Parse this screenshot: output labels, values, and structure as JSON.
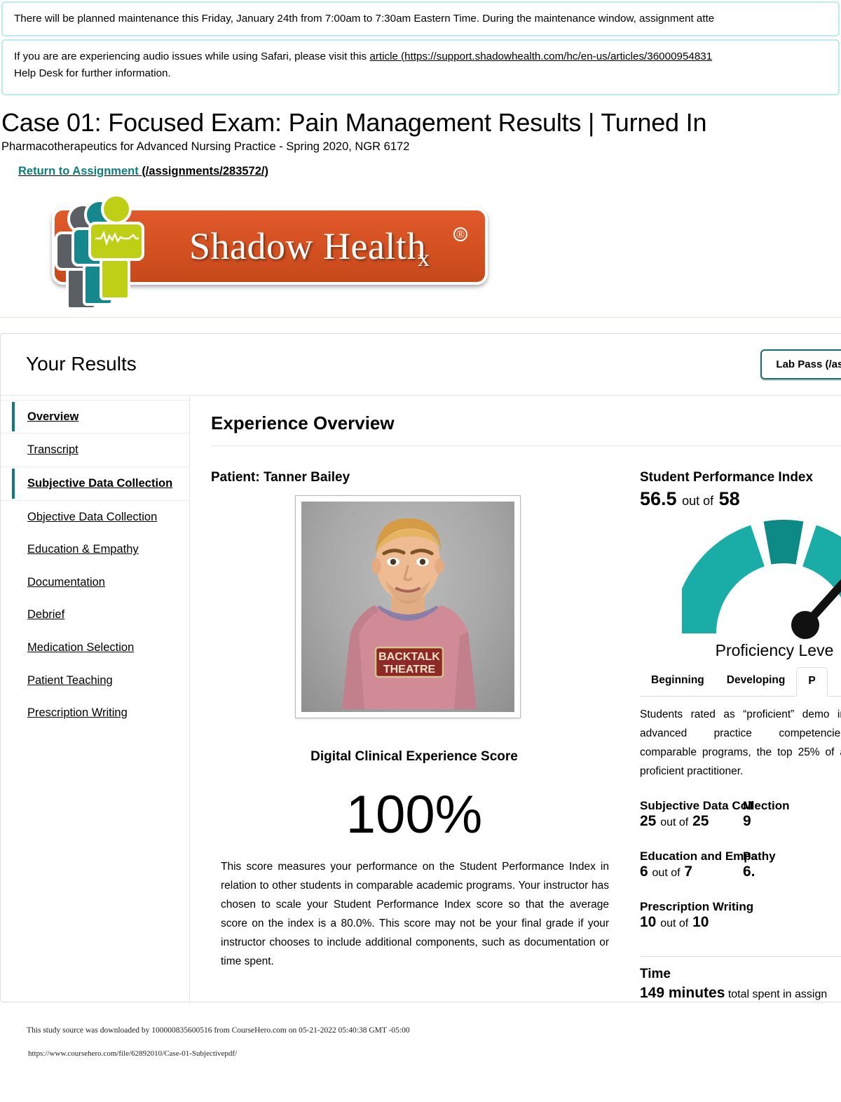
{
  "banners": [
    {
      "id": "maintenance-banner",
      "text": "There will be planned maintenance this Friday, January 24th from 7:00am to 7:30am Eastern Time. During the maintenance window, assignment atte"
    },
    {
      "id": "audio-banner",
      "text_before": "If you are are experiencing audio issues while using Safari, please visit this ",
      "link_text": "article (https://support.shadowhealth.com/hc/en-us/articles/36000954831",
      "text_after": "Help Desk for further information."
    }
  ],
  "header": {
    "title": "Case 01: Focused Exam: Pain Management Results | Turned In",
    "subtitle": "Pharmacotherapeutics for Advanced Nursing Practice - Spring 2020, NGR 6172",
    "return_link_label": "Return to Assignment ",
    "return_link_url_text": "(/assignments/283572/)"
  },
  "logo": {
    "wordmark": "Shadow Healt",
    "wordmark_tail": "h",
    "rx_mark": "x",
    "registered": "®",
    "colors": {
      "plate": "#d4501f",
      "gray_figure": "#5b5f63",
      "teal_figure": "#14888c",
      "lime_figure": "#bfcf16"
    }
  },
  "results_panel": {
    "heading": "Your Results",
    "lab_pass_button": "Lab Pass (/assignment_atte"
  },
  "sidebar": {
    "items": [
      {
        "label": "Overview",
        "active": true
      },
      {
        "label": "Transcript",
        "active": false
      },
      {
        "label": "Subjective Data Collection",
        "active": true
      },
      {
        "label": "Objective Data Collection",
        "active": false
      },
      {
        "label": "Education & Empathy",
        "active": false
      },
      {
        "label": "Documentation",
        "active": false
      },
      {
        "label": "Debrief",
        "active": false
      },
      {
        "label": "Medication Selection",
        "active": false
      },
      {
        "label": "Patient Teaching",
        "active": false
      },
      {
        "label": "Prescription Writing",
        "active": false
      }
    ]
  },
  "main": {
    "section_title": "Experience Overview",
    "patient_label": "Patient: Tanner Bailey",
    "avatar": {
      "shirt_text_line1": "BACKTALK",
      "shirt_text_line2": "THEATRE"
    },
    "dce": {
      "label": "Digital Clinical Experience Score",
      "score": "100%",
      "description": "This score measures your performance on the Student Performance Index in relation to other students in comparable academic programs. Your instructor has chosen to scale your Student Performance Index score so that the average score on the index is a 80.0%. This score may not be your final grade if your instructor chooses to include additional components, such as documentation or time spent."
    },
    "spi": {
      "title": "Student Performance Index",
      "score": "56.5",
      "out_of_word": "out of",
      "max": "58",
      "gauge_label": "Proficiency Leve",
      "accent_color": "#1aada8",
      "accent_dark": "#0d8a86"
    },
    "proficiency": {
      "tabs": [
        "Beginning",
        "Developing",
        "P"
      ],
      "selected_index": 2,
      "description": "Students rated as “proficient” demo in advanced practice competencies comparable programs, the top 25% of a proficient practitioner."
    },
    "scores": {
      "left": [
        {
          "name": "Subjective Data Collection",
          "value": "25",
          "out_of_word": "out of",
          "max": "25"
        },
        {
          "name": "Education and Empathy",
          "value": "6",
          "out_of_word": "out of",
          "max": "7"
        },
        {
          "name": "Prescription Writing",
          "value": "10",
          "out_of_word": "out of",
          "max": "10"
        }
      ],
      "right": [
        {
          "name": "M",
          "value": "9",
          "out_of_word": "",
          "max": ""
        },
        {
          "name": "Pa",
          "value": "6.",
          "out_of_word": "",
          "max": ""
        }
      ]
    },
    "time": {
      "title": "Time",
      "value": "149 minutes",
      "suffix": " total spent in assign"
    }
  },
  "watermark": {
    "line1": "This study source was downloaded by 100000835600516 from CourseHero.com on 05-21-2022 05:40:38 GMT -05:00",
    "line2": "https://www.coursehero.com/file/62892010/Case-01-Subjectivepdf/"
  }
}
